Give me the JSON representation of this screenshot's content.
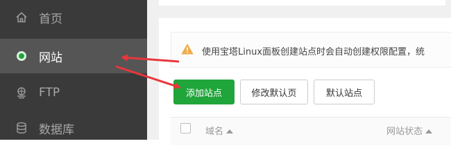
{
  "sidebar": {
    "items": [
      {
        "label": "首页",
        "icon": "home-icon",
        "active": false
      },
      {
        "label": "网站",
        "icon": "website-dot-icon",
        "active": true
      },
      {
        "label": "FTP",
        "icon": "ftp-icon",
        "active": false
      },
      {
        "label": "数据库",
        "icon": "database-icon",
        "active": false
      }
    ]
  },
  "alert": {
    "icon": "warning-icon",
    "text": "使用宝塔Linux面板创建站点时会自动创建权限配置，统"
  },
  "toolbar": {
    "add_site_label": "添加站点",
    "edit_default_page_label": "修改默认页",
    "default_site_label": "默认站点"
  },
  "table": {
    "columns": [
      "域名",
      "网站状态"
    ]
  },
  "colors": {
    "sidebar_bg": "#3a3a3a",
    "sidebar_active_bg": "#555555",
    "accent_green": "#20a53a",
    "annotation_red": "#e8373b",
    "warning_orange": "#f0ad4e"
  }
}
